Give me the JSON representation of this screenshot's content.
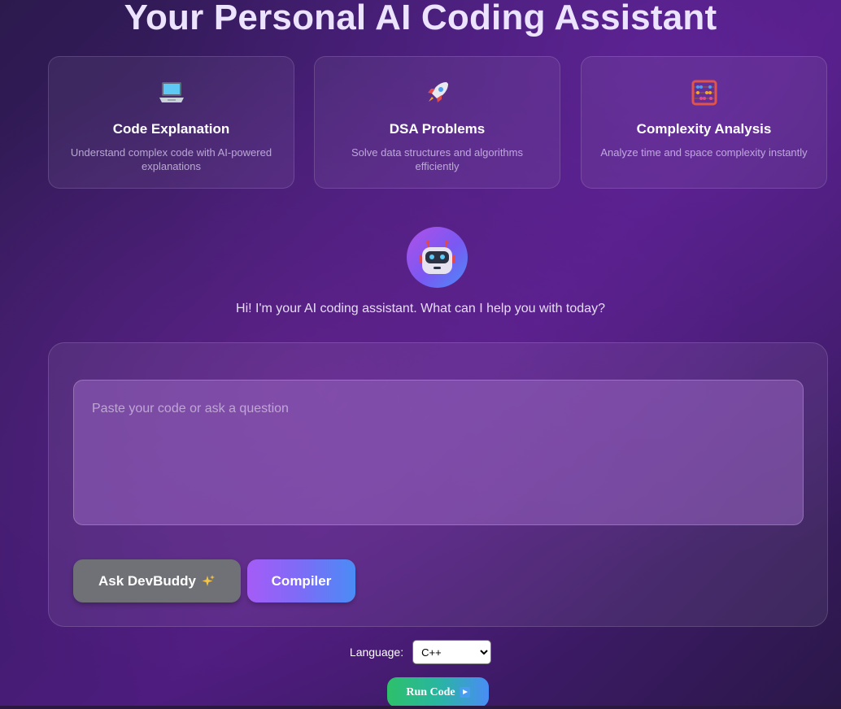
{
  "header": {
    "title": "Your Personal AI Coding Assistant"
  },
  "features": [
    {
      "icon": "laptop-icon",
      "title": "Code Explanation",
      "description": "Understand complex code with AI-powered explanations"
    },
    {
      "icon": "rocket-icon",
      "title": "DSA Problems",
      "description": "Solve data structures and algorithms efficiently"
    },
    {
      "icon": "abacus-icon",
      "title": "Complexity Analysis",
      "description": "Analyze time and space complexity instantly"
    }
  ],
  "assistant": {
    "avatar_icon": "robot-icon",
    "greeting": "Hi! I'm your AI coding assistant. What can I help you with today?"
  },
  "chat": {
    "input_placeholder": "Paste your code or ask a question",
    "input_value": "",
    "ask_label": "Ask DevBuddy",
    "ask_icon": "sparkles-icon",
    "compiler_label": "Compiler"
  },
  "compiler": {
    "language_label": "Language:",
    "language_selected": "C++",
    "run_label": "Run Code",
    "run_icon": "play-button-icon"
  },
  "colors": {
    "background": "#3d1c6a",
    "accent_gradient_start": "#a55cf7",
    "accent_gradient_end": "#4a8cf6",
    "ask_button": "#6f7177",
    "run_gradient_start": "#2ec06a"
  }
}
